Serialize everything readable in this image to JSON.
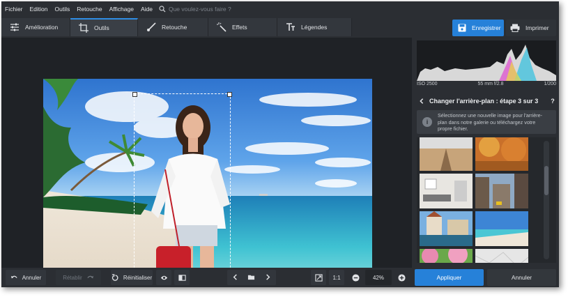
{
  "menu": {
    "items": [
      "Fichier",
      "Edition",
      "Outils",
      "Retouche",
      "Affichage",
      "Aide"
    ],
    "search_placeholder": "Que voulez-vous faire ?"
  },
  "tabs": [
    {
      "label": "Amélioration",
      "icon": "sliders-icon"
    },
    {
      "label": "Outils",
      "icon": "crop-icon",
      "active": true
    },
    {
      "label": "Retouche",
      "icon": "brush-icon"
    },
    {
      "label": "Effets",
      "icon": "magic-wand-icon"
    },
    {
      "label": "Légendes",
      "icon": "text-icon"
    }
  ],
  "toolbar": {
    "save_label": "Enregistrer",
    "print_label": "Imprimer"
  },
  "bottom": {
    "undo": "Annuler",
    "redo": "Rétablir",
    "reset": "Réinitialiser",
    "ratio": "1:1",
    "zoom": "42%"
  },
  "exif": {
    "iso": "ISO 2500",
    "lens": "55 mm f/2.8",
    "shutter": "1/200"
  },
  "panel": {
    "title": "Changer l'arrière-plan : étape 3 sur 3",
    "help": "?",
    "info_line1": "Sélectionnez une nouvelle image pour l'arrière-",
    "info_line2": "plan dans notre galerie ou téléchargez votre",
    "info_line3": "propre fichier.",
    "apply": "Appliquer",
    "cancel": "Annuler"
  },
  "colors": {
    "accent": "#2681d9",
    "bg": "#2b2e33",
    "canvas": "#1f2226"
  }
}
